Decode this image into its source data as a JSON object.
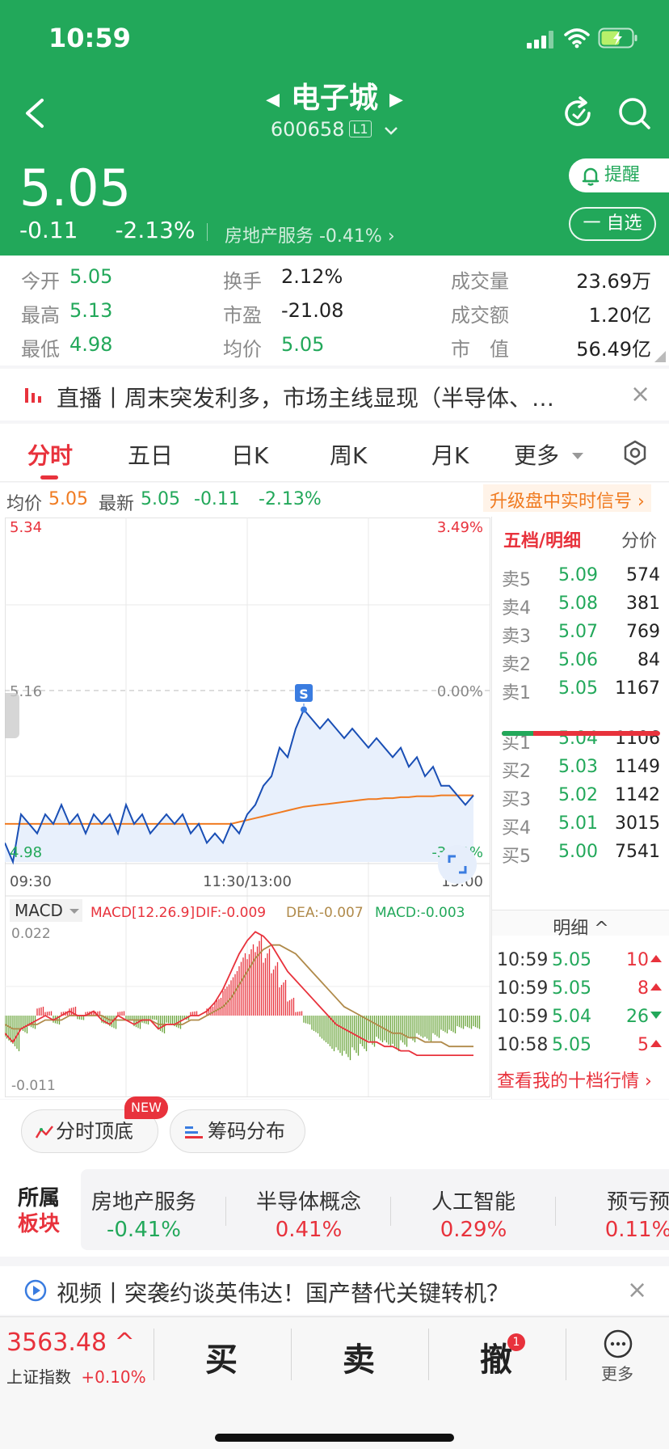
{
  "status": {
    "time": "10:59"
  },
  "header": {
    "name": "电子城",
    "code": "600658",
    "level": "L1",
    "price": "5.05",
    "change": "-0.11",
    "change_pct": "-2.13%",
    "sector_link": "房地产服务  -0.41%  ›",
    "remind": "提醒",
    "watch": "一 自选"
  },
  "stats": [
    {
      "k": "今开",
      "v": "5.05",
      "color": "green"
    },
    {
      "k": "最高",
      "v": "5.13",
      "color": "green"
    },
    {
      "k": "最低",
      "v": "4.98",
      "color": "green"
    },
    {
      "k": "换手",
      "v": "2.12%",
      "color": "black"
    },
    {
      "k": "市盈",
      "v": "-21.08",
      "color": "black"
    },
    {
      "k": "均价",
      "v": "5.05",
      "color": "green"
    },
    {
      "k": "成交量",
      "v": "23.69万",
      "color": "black"
    },
    {
      "k": "成交额",
      "v": "1.20亿",
      "color": "black"
    },
    {
      "k": "市　值",
      "v": "56.49亿",
      "color": "black"
    }
  ],
  "banner1": {
    "text": "直播丨周末突发利多，市场主线显现（半导体、…",
    "close": "×"
  },
  "tabs": [
    {
      "label": "分时",
      "active": true
    },
    {
      "label": "五日"
    },
    {
      "label": "日K"
    },
    {
      "label": "周K"
    },
    {
      "label": "月K"
    },
    {
      "label": "更多"
    }
  ],
  "info_line": {
    "avg_label": "均价",
    "avg_value": "5.05",
    "last_label": "最新",
    "last_value": "5.05",
    "change": "-0.11",
    "change_pct": "-2.13%",
    "upgrade": "升级盘中实时信号 ›"
  },
  "chart_data": {
    "type": "line",
    "title": "",
    "series": [
      {
        "name": "最新",
        "color": "#1a4fb5",
        "values": [
          5.0,
          4.98,
          5.03,
          5.02,
          5.01,
          5.03,
          5.02,
          5.04,
          5.02,
          5.03,
          5.01,
          5.03,
          5.02,
          5.03,
          5.01,
          5.04,
          5.02,
          5.03,
          5.01,
          5.02,
          5.03,
          5.02,
          5.03,
          5.01,
          5.02,
          5.0,
          5.01,
          5.0,
          5.02,
          5.01,
          5.03,
          5.04,
          5.06,
          5.07,
          5.1,
          5.09,
          5.12,
          5.14,
          5.13,
          5.12,
          5.13,
          5.12,
          5.11,
          5.12,
          5.11,
          5.1,
          5.11,
          5.1,
          5.09,
          5.1,
          5.08,
          5.09,
          5.07,
          5.08,
          5.06,
          5.06,
          5.05,
          5.04,
          5.05
        ]
      },
      {
        "name": "均价",
        "color": "#f07b21",
        "values": [
          5.02,
          5.02,
          5.02,
          5.02,
          5.02,
          5.02,
          5.02,
          5.02,
          5.02,
          5.02,
          5.02,
          5.02,
          5.02,
          5.02,
          5.02,
          5.02,
          5.02,
          5.02,
          5.02,
          5.02,
          5.02,
          5.02,
          5.02,
          5.02,
          5.02,
          5.02,
          5.02,
          5.02,
          5.02,
          5.022,
          5.024,
          5.026,
          5.028,
          5.03,
          5.032,
          5.034,
          5.036,
          5.038,
          5.039,
          5.04,
          5.041,
          5.042,
          5.043,
          5.044,
          5.045,
          5.046,
          5.046,
          5.047,
          5.047,
          5.048,
          5.048,
          5.049,
          5.049,
          5.049,
          5.05,
          5.05,
          5.05,
          5.05,
          5.05
        ]
      }
    ],
    "ylim": [
      4.98,
      5.34
    ],
    "prev_close": 5.16,
    "y_labels_left": [
      "5.34",
      "5.16",
      "4.98"
    ],
    "y_labels_right": [
      "3.49%",
      "0.00%",
      "-3.49%"
    ],
    "x_labels": [
      "09:30",
      "11:30/13:00",
      "15:00"
    ],
    "total_slots": 241,
    "marker": "S"
  },
  "macd": {
    "selector": "MACD",
    "params": "MACD[12.26.9]",
    "dif": "DIF:-0.009",
    "dea": "DEA:-0.007",
    "macd": "MACD:-0.003",
    "y_top": "0.022",
    "y_bottom": "-0.011",
    "ylim": [
      -0.011,
      0.022
    ],
    "bars": [
      -0.006,
      -0.008,
      -0.004,
      -0.003,
      0.002,
      0.001,
      -0.002,
      0.001,
      0.002,
      -0.001,
      0.001,
      0.001,
      -0.002,
      -0.003,
      0.001,
      -0.001,
      -0.003,
      -0.002,
      -0.001,
      -0.004,
      -0.002,
      -0.003,
      -0.001,
      0.001,
      0.0,
      0.002,
      0.004,
      0.007,
      0.01,
      0.014,
      0.016,
      0.018,
      0.015,
      0.012,
      0.008,
      0.004,
      0.001,
      -0.002,
      -0.004,
      -0.006,
      -0.008,
      -0.009,
      -0.01,
      -0.009,
      -0.008,
      -0.007,
      -0.006,
      -0.007,
      -0.008,
      -0.007,
      -0.006,
      -0.005,
      -0.006,
      -0.005,
      -0.004,
      -0.004,
      -0.003,
      -0.003,
      -0.003
    ],
    "dif_line": [
      -0.004,
      -0.006,
      -0.003,
      -0.002,
      -0.001,
      0.0,
      -0.001,
      0.0,
      0.001,
      0.0,
      0.0,
      0.001,
      -0.001,
      -0.002,
      0.0,
      -0.001,
      -0.002,
      -0.001,
      -0.001,
      -0.003,
      -0.002,
      -0.002,
      -0.001,
      0.0,
      0.0,
      0.001,
      0.003,
      0.006,
      0.01,
      0.014,
      0.017,
      0.019,
      0.018,
      0.016,
      0.013,
      0.01,
      0.008,
      0.006,
      0.004,
      0.002,
      0.0,
      -0.002,
      -0.003,
      -0.004,
      -0.005,
      -0.006,
      -0.006,
      -0.007,
      -0.007,
      -0.008,
      -0.008,
      -0.009,
      -0.009,
      -0.009,
      -0.009,
      -0.009,
      -0.009,
      -0.009,
      -0.009
    ],
    "dea_line": [
      -0.002,
      -0.003,
      -0.003,
      -0.002,
      -0.002,
      -0.001,
      -0.001,
      -0.001,
      0.0,
      0.0,
      0.0,
      0.0,
      0.0,
      -0.001,
      -0.001,
      -0.001,
      -0.001,
      -0.001,
      -0.001,
      -0.002,
      -0.002,
      -0.002,
      -0.002,
      -0.001,
      -0.001,
      0.0,
      0.001,
      0.002,
      0.004,
      0.007,
      0.01,
      0.013,
      0.015,
      0.016,
      0.016,
      0.015,
      0.014,
      0.012,
      0.01,
      0.008,
      0.006,
      0.004,
      0.002,
      0.001,
      0.0,
      -0.001,
      -0.002,
      -0.003,
      -0.004,
      -0.004,
      -0.005,
      -0.005,
      -0.006,
      -0.006,
      -0.006,
      -0.007,
      -0.007,
      -0.007,
      -0.007
    ]
  },
  "order_book": {
    "tab_active": "五档/明细",
    "tab_other": "分价",
    "asks": [
      {
        "label": "卖5",
        "price": "5.09",
        "qty": "574"
      },
      {
        "label": "卖4",
        "price": "5.08",
        "qty": "381"
      },
      {
        "label": "卖3",
        "price": "5.07",
        "qty": "769"
      },
      {
        "label": "卖2",
        "price": "5.06",
        "qty": "84"
      },
      {
        "label": "卖1",
        "price": "5.05",
        "qty": "1167"
      }
    ],
    "buy_ratio": 0.2,
    "bids": [
      {
        "label": "买1",
        "price": "5.04",
        "qty": "1106"
      },
      {
        "label": "买2",
        "price": "5.03",
        "qty": "1149"
      },
      {
        "label": "买3",
        "price": "5.02",
        "qty": "1142"
      },
      {
        "label": "买4",
        "price": "5.01",
        "qty": "3015"
      },
      {
        "label": "买5",
        "price": "5.00",
        "qty": "7541"
      }
    ],
    "detail_head": "明细 ^",
    "trades": [
      {
        "time": "10:59",
        "price": "5.05",
        "qty": "10",
        "dir": "up"
      },
      {
        "time": "10:59",
        "price": "5.05",
        "qty": "8",
        "dir": "up"
      },
      {
        "time": "10:59",
        "price": "5.04",
        "qty": "26",
        "dir": "down"
      },
      {
        "time": "10:58",
        "price": "5.05",
        "qty": "5",
        "dir": "up"
      }
    ],
    "my_ten": "查看我的十档行情 ›"
  },
  "chips": {
    "tops": "分时顶底",
    "new_badge": "NEW",
    "chips": "筹码分布"
  },
  "sector": {
    "label_a": "所属",
    "label_b": "板块",
    "items": [
      {
        "name": "房地产服务",
        "value": "-0.41%",
        "color": "green"
      },
      {
        "name": "半导体概念",
        "value": "0.41%",
        "color": "red"
      },
      {
        "name": "人工智能",
        "value": "0.29%",
        "color": "red"
      },
      {
        "name": "预亏预",
        "value": "0.11%",
        "color": "red"
      }
    ]
  },
  "banner2": {
    "text": "视频丨突袭约谈英伟达！国产替代关键转机？",
    "close": "×"
  },
  "bottom": {
    "index_value": "3563.48 ^",
    "index_name": "上证指数",
    "index_change": "+0.10%",
    "buy": "买",
    "sell": "卖",
    "cancel": "撤",
    "cancel_badge": "1",
    "more": "更多"
  }
}
